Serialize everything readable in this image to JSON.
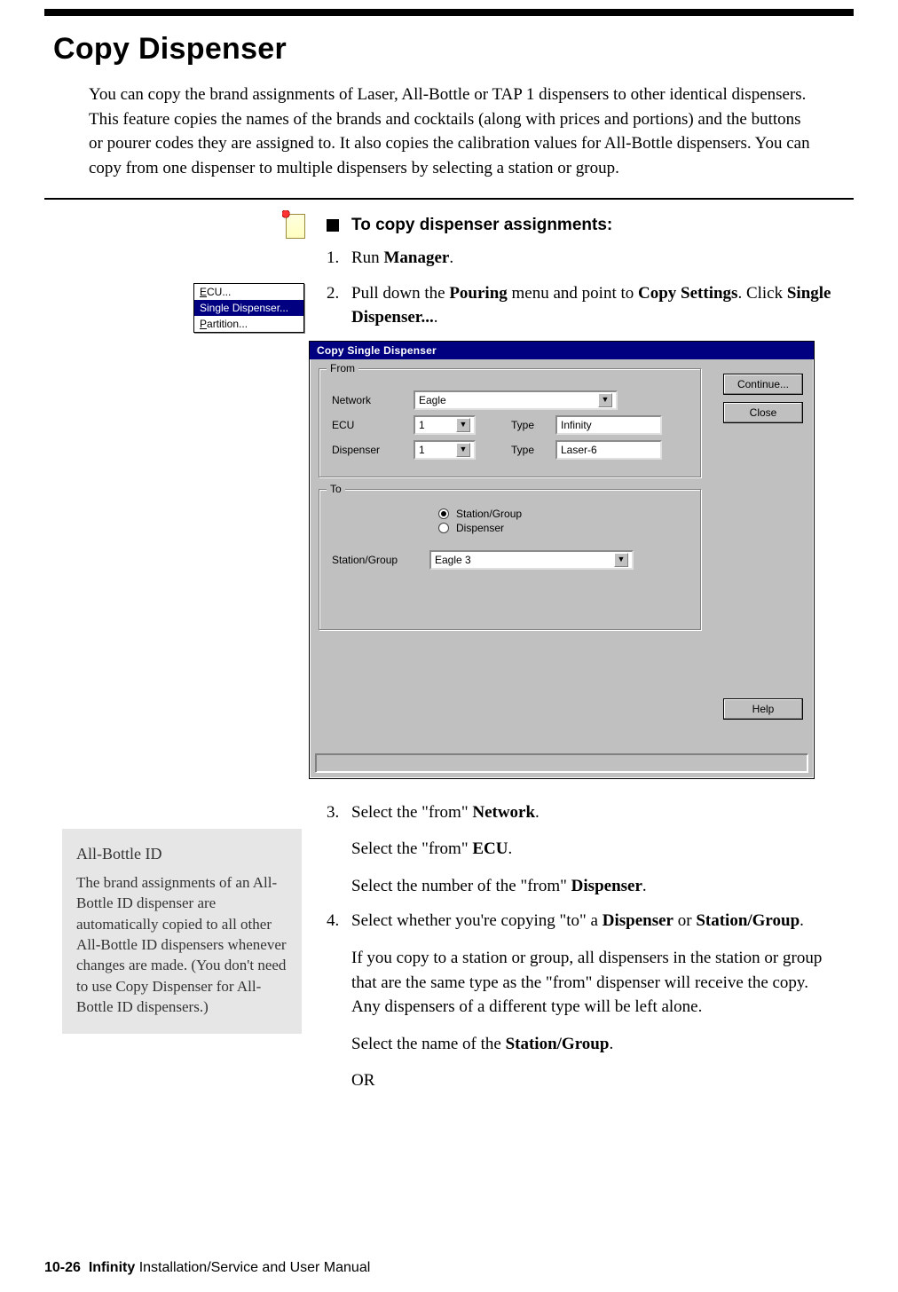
{
  "page_title": "Copy Dispenser",
  "intro_text": "You can copy the brand assignments of Laser, All-Bottle or TAP 1 dispensers to other identical dispensers. This feature copies the names of the brands and cocktails (along with prices and portions) and the buttons or pourer codes they are assigned to. It also copies the calibration values for All-Bottle dispensers. You can copy from one dispenser to multiple dispensers by selecting a station or group.",
  "task_heading": "To copy dispenser assignments:",
  "menu": {
    "item1_prefix": "E",
    "item1_rest": "CU...",
    "item2": "Single Dispenser...",
    "item3_prefix": "P",
    "item3_rest": "artition..."
  },
  "steps": {
    "s1_pre": "Run ",
    "s1_bold": "Manager",
    "s1_post": ".",
    "s2_pre": "Pull down the ",
    "s2_b1": "Pouring",
    "s2_mid": " menu and point to ",
    "s2_b2": "Copy Settings",
    "s2_mid2": ". Click ",
    "s2_b3": "Single Dispenser...",
    "s2_post": ".",
    "s3_pre": "Select the \"from\" ",
    "s3_b": "Network",
    "s3_post": ".",
    "s3a_pre": "Select the \"from\" ",
    "s3a_b": "ECU",
    "s3a_post": ".",
    "s3b_pre": "Select the number of the \"from\" ",
    "s3b_b": "Dispenser",
    "s3b_post": ".",
    "s4_pre": "Select whether you're copying \"to\" a ",
    "s4_b1": "Dispenser",
    "s4_mid": " or ",
    "s4_b2": "Station/Group",
    "s4_post": ".",
    "s4a": "If you copy to a station or group, all dispensers in the station or group that are the same type as the \"from\" dispenser will receive the copy. Any dispensers of a different type will be left alone.",
    "s4b_pre": "Select the name of the ",
    "s4b_b": "Station/Group",
    "s4b_post": ".",
    "s4c": "OR"
  },
  "dialog": {
    "title": "Copy Single Dispenser",
    "from_legend": "From",
    "to_legend": "To",
    "lbl_network": "Network",
    "lbl_ecu": "ECU",
    "lbl_dispenser": "Dispenser",
    "lbl_type": "Type",
    "lbl_stationgroup": "Station/Group",
    "val_network": "Eagle",
    "val_ecu": "1",
    "val_ecu_type": "Infinity",
    "val_disp": "1",
    "val_disp_type": "Laser-6",
    "radio_station": "Station/Group",
    "radio_dispenser": "Dispenser",
    "val_to_station": "Eagle 3",
    "btn_continue": "Continue...",
    "btn_close": "Close",
    "btn_help": "Help"
  },
  "sidebar": {
    "title": "All-Bottle ID",
    "body": "The brand assignments of an All-Bottle ID dispenser are automatically copied to all other All-Bottle ID dispensers whenever changes are made. (You don't need to use Copy Dispenser for All-Bottle ID dispensers.)"
  },
  "footer": {
    "page_label": "10-26",
    "product": "Infinity",
    "rest": " Installation/Service and User Manual"
  }
}
